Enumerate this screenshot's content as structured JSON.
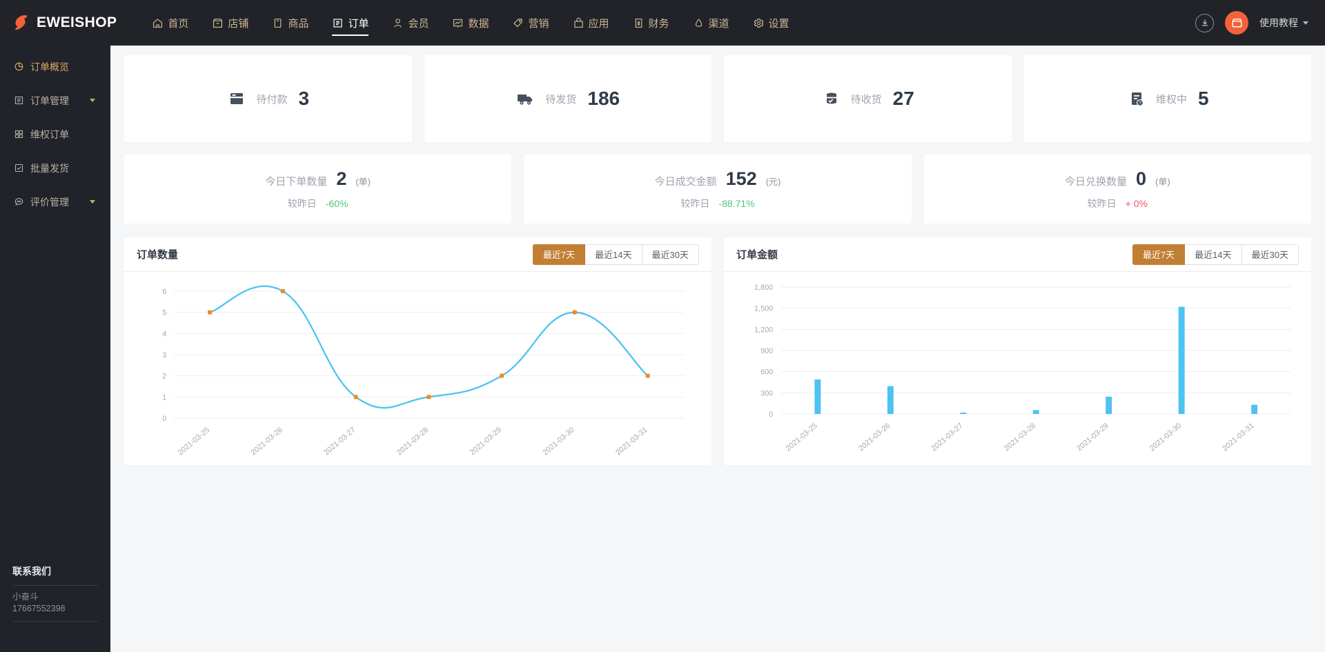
{
  "header": {
    "brand": "EWEISHOP",
    "brand_icon": "eweishop-logo-icon",
    "nav": [
      {
        "label": "首页",
        "icon": "home-icon",
        "active": false
      },
      {
        "label": "店铺",
        "icon": "shop-icon",
        "active": false
      },
      {
        "label": "商品",
        "icon": "goods-icon",
        "active": false
      },
      {
        "label": "订单",
        "icon": "order-icon",
        "active": true
      },
      {
        "label": "会员",
        "icon": "member-icon",
        "active": false
      },
      {
        "label": "数据",
        "icon": "data-icon",
        "active": false
      },
      {
        "label": "营销",
        "icon": "marketing-icon",
        "active": false
      },
      {
        "label": "应用",
        "icon": "app-icon",
        "active": false
      },
      {
        "label": "财务",
        "icon": "finance-icon",
        "active": false
      },
      {
        "label": "渠道",
        "icon": "channel-icon",
        "active": false
      },
      {
        "label": "设置",
        "icon": "settings-icon",
        "active": false
      }
    ],
    "download_icon": "download-icon",
    "avatar_icon": "shop-avatar-icon",
    "tutorial_label": "使用教程",
    "tutorial_caret": "chevron-down-icon",
    "accent_color": "#f4623a"
  },
  "sidebar": {
    "items": [
      {
        "label": "订单概览",
        "icon": "pie-chart-icon",
        "active": true,
        "expandable": false
      },
      {
        "label": "订单管理",
        "icon": "list-icon",
        "active": false,
        "expandable": true
      },
      {
        "label": "维权订单",
        "icon": "grid-icon",
        "active": false,
        "expandable": false
      },
      {
        "label": "批量发货",
        "icon": "checkbox-icon",
        "active": false,
        "expandable": false
      },
      {
        "label": "评价管理",
        "icon": "comment-icon",
        "active": false,
        "expandable": true
      }
    ],
    "contact": {
      "title": "联系我们",
      "name": "小奋斗",
      "phone": "17667552398"
    },
    "active_color": "#d9a861"
  },
  "stats": [
    {
      "label": "待付款",
      "value": "3",
      "icon": "card-icon"
    },
    {
      "label": "待发货",
      "value": "186",
      "icon": "truck-icon"
    },
    {
      "label": "待收货",
      "value": "27",
      "icon": "parcel-check-icon"
    },
    {
      "label": "维权中",
      "value": "5",
      "icon": "doc-question-icon"
    }
  ],
  "compare_cards": [
    {
      "title": "今日下单数量",
      "value": "2",
      "unit": "(单)",
      "sub_label": "较昨日",
      "delta": "-60%",
      "delta_dir": "down"
    },
    {
      "title": "今日成交金额",
      "value": "152",
      "unit": "(元)",
      "sub_label": "较昨日",
      "delta": "-88.71%",
      "delta_dir": "down"
    },
    {
      "title": "今日兑换数量",
      "value": "0",
      "unit": "(单)",
      "sub_label": "较昨日",
      "delta": "+ 0%",
      "delta_dir": "up"
    }
  ],
  "charts": {
    "range_tabs": [
      "最近7天",
      "最近14天",
      "最近30天"
    ],
    "selected_range": "最近7天"
  },
  "chart_data": [
    {
      "type": "line",
      "title": "订单数量",
      "xlabel": "",
      "ylabel": "",
      "categories": [
        "2021-03-25",
        "2021-03-26",
        "2021-03-27",
        "2021-03-28",
        "2021-03-29",
        "2021-03-30",
        "2021-03-31"
      ],
      "values": [
        5,
        6,
        1,
        1,
        2,
        5,
        2
      ],
      "yticks": [
        0,
        1,
        2,
        3,
        4,
        5,
        6
      ],
      "ylim": [
        0,
        6
      ],
      "grid": true,
      "legend": "none",
      "line_color": "#4cc3f0",
      "point_color": "#f08b1d",
      "smooth": true
    },
    {
      "type": "bar",
      "title": "订单金额",
      "xlabel": "",
      "ylabel": "",
      "categories": [
        "2021-03-25",
        "2021-03-26",
        "2021-03-27",
        "2021-03-28",
        "2021-03-29",
        "2021-03-30",
        "2021-03-31"
      ],
      "values": [
        490,
        395,
        15,
        55,
        245,
        1520,
        130
      ],
      "yticks": [
        0,
        300,
        600,
        900,
        1200,
        1500,
        1800
      ],
      "ytick_labels": [
        "0",
        "300",
        "600",
        "900",
        "1,200",
        "1,500",
        "1,800"
      ],
      "ylim": [
        0,
        1800
      ],
      "grid": true,
      "legend": "none",
      "bar_color": "#4cc3f0"
    }
  ]
}
